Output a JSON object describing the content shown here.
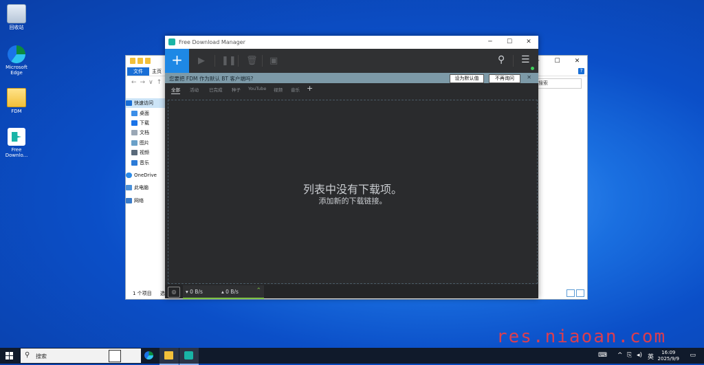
{
  "desktop": {
    "icons": [
      {
        "label": "回收站"
      },
      {
        "label": "Microsoft Edge"
      },
      {
        "label": "FDM"
      },
      {
        "label": "Free Downlo..."
      }
    ]
  },
  "explorer": {
    "tabs": {
      "file": "文件",
      "home": "主页"
    },
    "search_placeholder": "搜索",
    "nav": [
      {
        "label": "快速访问"
      },
      {
        "label": "桌面"
      },
      {
        "label": "下载"
      },
      {
        "label": "文档"
      },
      {
        "label": "图片"
      },
      {
        "label": "视频"
      },
      {
        "label": "音乐"
      },
      {
        "label": "OneDrive"
      },
      {
        "label": "此电脑"
      },
      {
        "label": "网络"
      }
    ],
    "status": "1 个项目",
    "status2": "选"
  },
  "fdm": {
    "title": "Free Download Manager",
    "banner": {
      "text": "您要把 FDM 作为默认 BT 客户端吗?",
      "set_default": "设为默认值",
      "no_ask": "不再询问"
    },
    "tabs": [
      "全部",
      "活动",
      "已完成",
      "种子",
      "YouTube",
      "视频",
      "音乐"
    ],
    "empty_main": "列表中没有下载项。",
    "empty_sub": "添加新的下载链接。",
    "speed_down": "0 B/s",
    "speed_up": "0 B/s"
  },
  "watermark": "res.niaoan.com",
  "taskbar": {
    "search_label": "搜索",
    "ime": "英",
    "time": "16:09",
    "date": "2025/9/9"
  }
}
